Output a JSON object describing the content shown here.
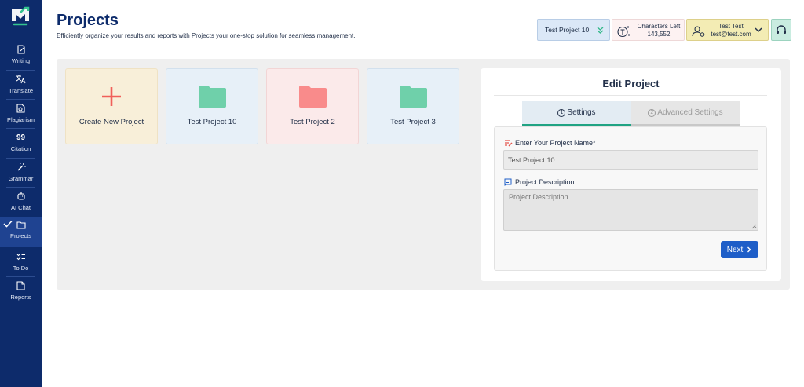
{
  "sidebar": {
    "items": [
      {
        "label": "Writing",
        "icon": "writing-icon"
      },
      {
        "label": "Translate",
        "icon": "translate-icon"
      },
      {
        "label": "Plagiarism",
        "icon": "plagiarism-icon"
      },
      {
        "label": "Citation",
        "icon": "citation-icon",
        "glyph": "99"
      },
      {
        "label": "Grammar",
        "icon": "grammar-wand-icon"
      },
      {
        "label": "AI Chat",
        "icon": "ai-chat-icon"
      },
      {
        "label": "Projects",
        "icon": "folder-icon",
        "active": true
      },
      {
        "label": "To Do",
        "icon": "todo-icon"
      },
      {
        "label": "Reports",
        "icon": "reports-icon"
      }
    ]
  },
  "header": {
    "title": "Projects",
    "subtitle": "Efficiently organize your results and reports with Projects your one-stop solution for seamless management.",
    "project_selector": "Test Project 10",
    "characters_label": "Characters Left",
    "characters_value": "143,552",
    "user_name": "Test Test",
    "user_email": "test@test.com"
  },
  "cards": {
    "new": "Create New Project",
    "p10": "Test Project 10",
    "p2": "Test Project 2",
    "p3": "Test Project 3"
  },
  "edit": {
    "title": "Edit Project",
    "tab_settings_num": "1",
    "tab_settings": "Settings",
    "tab_advanced_num": "2",
    "tab_advanced": "Advanced Settings",
    "name_label": "Enter Your Project Name*",
    "name_value": "Test Project 10",
    "desc_label": "Project Description",
    "desc_placeholder": "Project Description",
    "next_label": "Next"
  },
  "colors": {
    "sidebar_bg": "#0d2b6b",
    "accent_green": "#20a383",
    "next_button": "#1e5ec8",
    "folder_green": "#6fd0aa",
    "folder_red": "#f98b8b",
    "plus_red": "#f0605a"
  }
}
